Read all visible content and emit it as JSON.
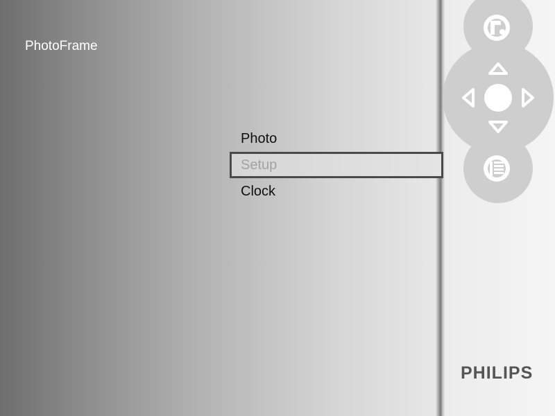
{
  "app": {
    "title": "PhotoFrame",
    "brand": "PHILIPS"
  },
  "menu": {
    "items": [
      {
        "label": "Photo",
        "selected": false
      },
      {
        "label": "Setup",
        "selected": true
      },
      {
        "label": "Clock",
        "selected": false
      }
    ]
  },
  "remote": {
    "top_button_icon": "slideshow-icon",
    "dpad_icons": [
      "arrow-up-icon",
      "arrow-down-icon",
      "arrow-left-icon",
      "arrow-right-icon"
    ],
    "bottom_button_icon": "menu-icon"
  },
  "colors": {
    "selection_border": "#4a4a4a",
    "selected_text": "#a2a2a2",
    "menu_text": "#101010",
    "remote_shape": "#cecece",
    "brand_text": "#555555"
  }
}
